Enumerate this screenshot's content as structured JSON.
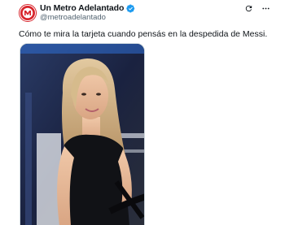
{
  "account": {
    "display_name": "Un Metro Adelantado",
    "handle": "@metroadelantado",
    "verified": true,
    "avatar_icon": "metro-logo-icon",
    "brand_color": "#d8232a",
    "verified_color": "#1d9bf0"
  },
  "actions": {
    "refresh_icon": "refresh-icon",
    "more_icon": "more-options-icon"
  },
  "tweet": {
    "text": "Cómo te mira la tarjeta cuando pensás en la despedida de Messi."
  },
  "media": {
    "type": "photo"
  }
}
